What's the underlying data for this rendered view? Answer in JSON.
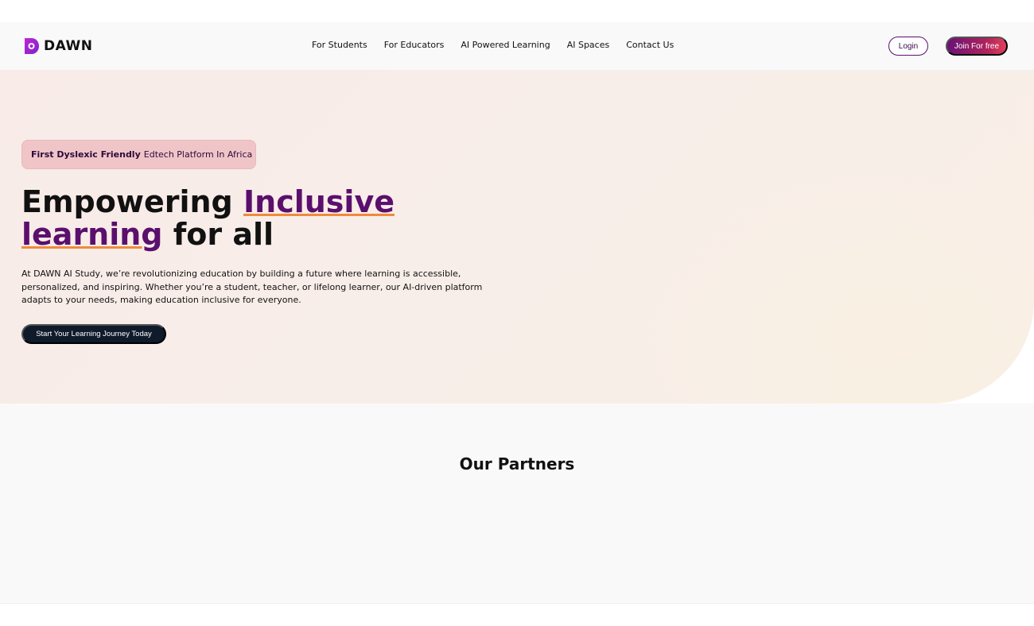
{
  "brand": {
    "name": "DAWN",
    "logo_icon": "dawn-d-logo-icon",
    "colors": {
      "primary": "#5b0f6d",
      "accent_underline": "#f08a3a",
      "join_gradient_start": "#6a1277",
      "join_gradient_end": "#e2415a",
      "cta_background": "#0f1a2a",
      "badge_background": "#f0c5c8"
    }
  },
  "nav": {
    "links": [
      {
        "label": "For Students"
      },
      {
        "label": "For Educators"
      },
      {
        "label": "AI Powered Learning"
      },
      {
        "label": "AI Spaces"
      },
      {
        "label": "Contact Us"
      }
    ],
    "login_label": "Login",
    "join_label": "Join For free"
  },
  "hero": {
    "badge": {
      "strong": "First Dyslexic Friendly",
      "rest": "Edtech Platform In Africa"
    },
    "headline": {
      "part1": "Empowering ",
      "highlight1": "Inclusive",
      "highlight2": "learning",
      "part2": " for all"
    },
    "description": "At DAWN AI Study, we’re revolutionizing education by building a future where learning is accessible, personalized, and inspiring. Whether you’re a student, teacher, or lifelong learner, our AI-driven platform adapts to your needs, making education inclusive for everyone.",
    "cta_label": "Start Your Learning Journey Today"
  },
  "partners": {
    "title": "Our Partners"
  }
}
